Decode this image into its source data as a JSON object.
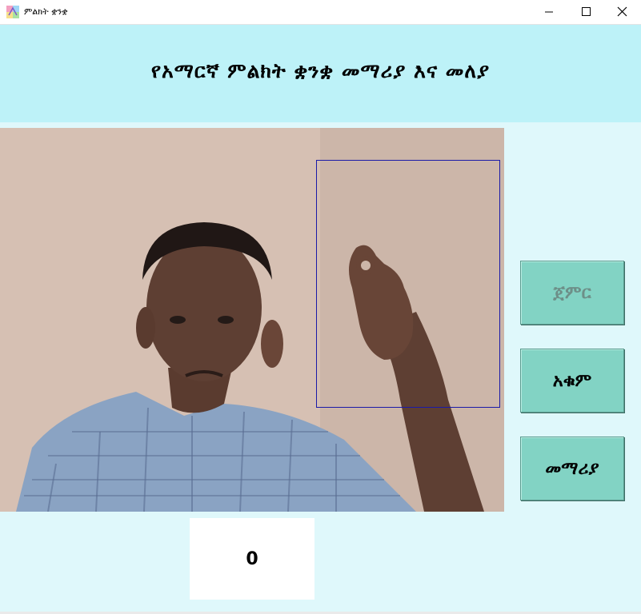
{
  "window": {
    "title": "ምልክት ቋንቋ",
    "icon": "colorful-app-icon",
    "controls": [
      "minimize-icon",
      "maximize-icon",
      "close-icon"
    ]
  },
  "header": {
    "title": "የአማርኛ ምልክት ቋንቋ መማሪያ እና መለያ",
    "background": "#bdf2f8"
  },
  "camera": {
    "roi_border_color": "#1a1aa8"
  },
  "buttons": {
    "start": "ጀምር",
    "stop": "አቁም",
    "learn": "መማሪያ",
    "color": "#82d3c4"
  },
  "result": {
    "value": "0"
  },
  "colors": {
    "window_bg": "#dff8fb"
  }
}
